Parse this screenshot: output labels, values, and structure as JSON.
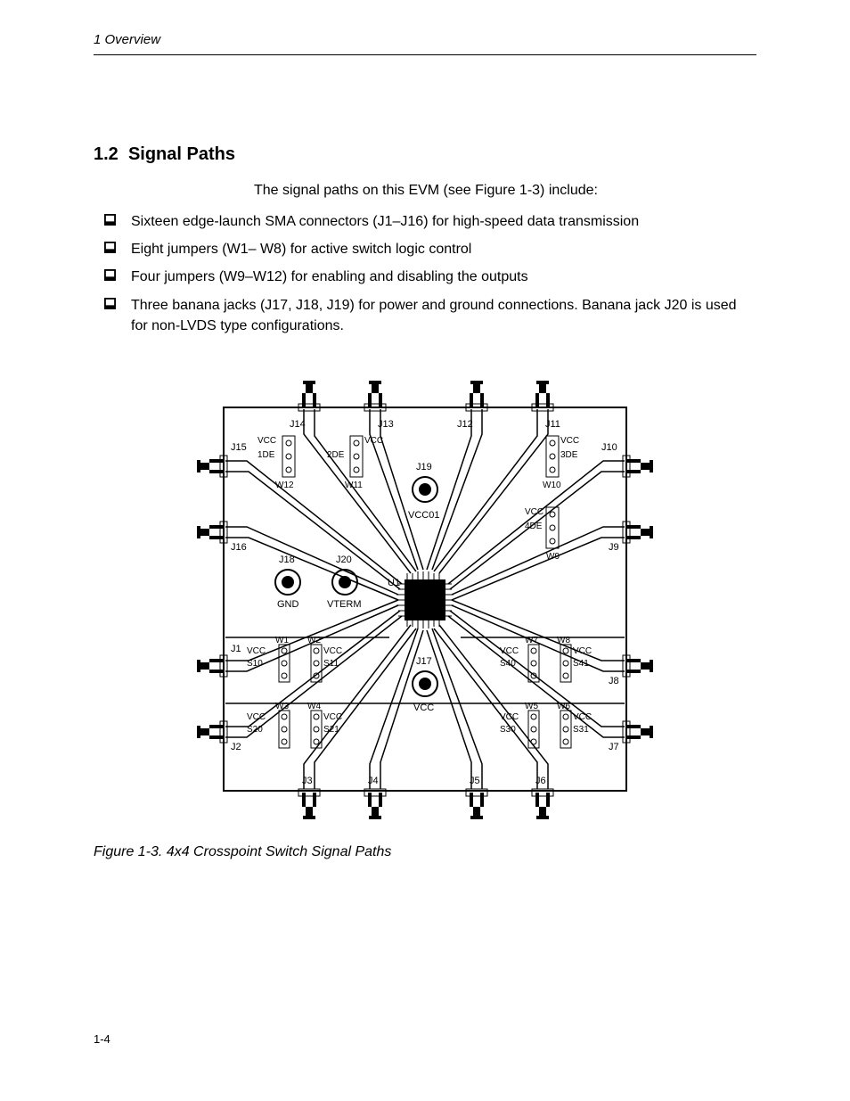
{
  "header": {
    "running": "1  Overview"
  },
  "section": {
    "number": "1.2",
    "title": "Signal Paths",
    "intro": "The signal paths on this EVM (see Figure 1-3) include:",
    "bullets": [
      "Sixteen edge-launch SMA connectors (J1–J16) for high-speed data transmission",
      "Eight jumpers (W1– W8) for active switch logic control",
      "Four jumpers (W9–W12) for enabling and disabling the outputs",
      "Three banana jacks (J17, J18, J19) for power and ground connections. Banana jack J20 is used for non-LVDS type configurations."
    ]
  },
  "figure": {
    "caption": "Figure 1-3. 4x4 Crosspoint Switch Signal Paths",
    "labels": {
      "U1": "U1",
      "VCC": "VCC",
      "VCC01": "VCC01",
      "GND": "GND",
      "VTERM": "VTERM",
      "J1": "J1",
      "J2": "J2",
      "J3": "J3",
      "J4": "J4",
      "J5": "J5",
      "J6": "J6",
      "J7": "J7",
      "J8": "J8",
      "J9": "J9",
      "J10": "J10",
      "J11": "J11",
      "J12": "J12",
      "J13": "J13",
      "J14": "J14",
      "J15": "J15",
      "J16": "J16",
      "J17": "J17",
      "J18": "J18",
      "J19": "J19",
      "J20": "J20",
      "W1": "W1",
      "W2": "W2",
      "W3": "W3",
      "W4": "W4",
      "W5": "W5",
      "W6": "W6",
      "W7": "W7",
      "W8": "W8",
      "W9": "W9",
      "W10": "W10",
      "W11": "W11",
      "W12": "W12",
      "S10": "S10",
      "S11": "S11",
      "S20": "S20",
      "S21": "S21",
      "S30": "S30",
      "S31": "S31",
      "S40": "S40",
      "S41": "S41",
      "DE1": "1DE",
      "DE2": "2DE",
      "DE3": "3DE",
      "DE4": "4DE"
    }
  },
  "pagenum": "1-4"
}
